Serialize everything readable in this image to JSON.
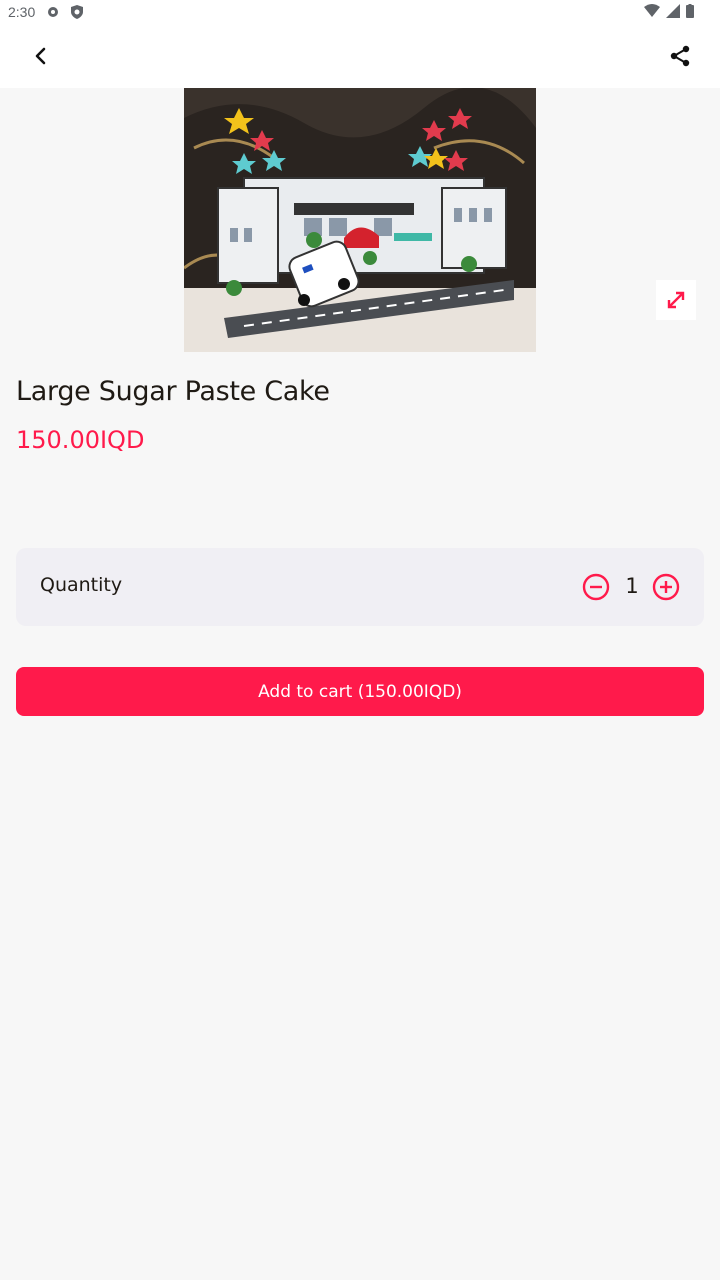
{
  "status_bar": {
    "time": "2:30"
  },
  "product": {
    "title": "Large Sugar Paste Cake",
    "price": "150.00IQD",
    "image_alt": "cake-photo"
  },
  "quantity": {
    "label": "Quantity",
    "value": "1"
  },
  "cart": {
    "button_label": "Add to cart (150.00IQD)"
  },
  "colors": {
    "accent": "#ff1a4b",
    "card": "#f0eff4",
    "background": "#f7f7f7"
  },
  "icons": {
    "back": "back-arrow-icon",
    "share": "share-icon",
    "expand": "expand-icon",
    "minus": "minus-circle-icon",
    "plus": "plus-circle-icon"
  }
}
